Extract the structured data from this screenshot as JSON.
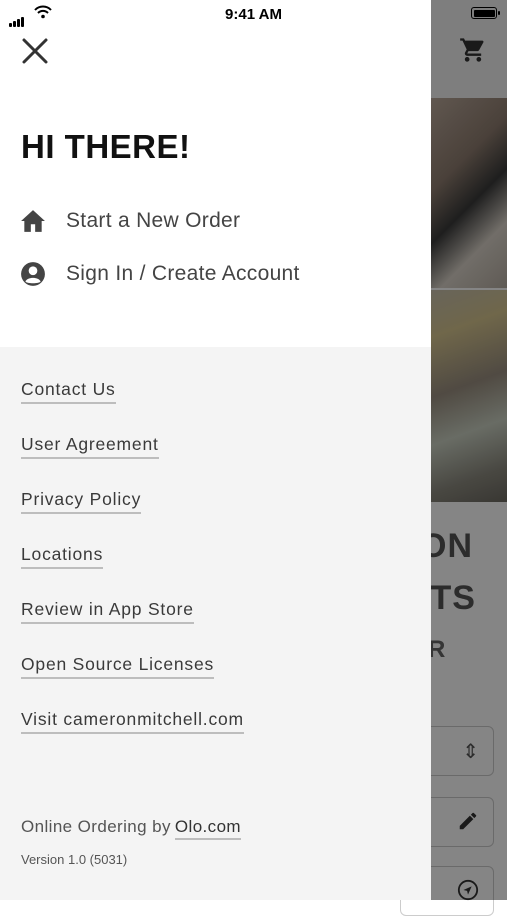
{
  "status_bar": {
    "time": "9:41 AM"
  },
  "background": {
    "title_lines": "ON\nITS",
    "subtitle": "R"
  },
  "drawer": {
    "greeting": "HI THERE!",
    "menu": [
      {
        "label": "Start a New Order",
        "icon": "home-icon"
      },
      {
        "label": "Sign In / Create Account",
        "icon": "account-circle-icon"
      }
    ],
    "links": [
      "Contact Us",
      "User Agreement",
      "Privacy Policy",
      "Locations",
      "Review in App Store",
      "Open Source Licenses",
      "Visit cameronmitchell.com"
    ],
    "footer": {
      "prefix": "Online Ordering by",
      "link": "Olo.com",
      "version": "Version 1.0 (5031)"
    }
  }
}
